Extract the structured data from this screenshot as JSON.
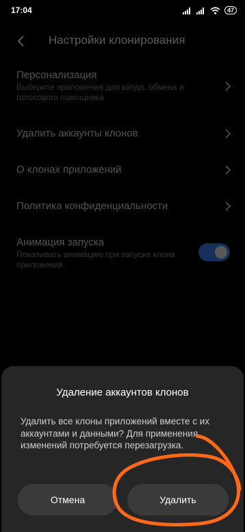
{
  "status_bar": {
    "time": "17:04",
    "battery": "47"
  },
  "header": {
    "title": "Настройки клонирования"
  },
  "settings": [
    {
      "title": "Персонализация",
      "subtitle": "Выберите приложения для входа, обмена и голосового помощника"
    },
    {
      "title": "Удалить аккаунты клонов",
      "subtitle": ""
    },
    {
      "title": "О клонах приложений",
      "subtitle": ""
    },
    {
      "title": "Политика конфиденциальности",
      "subtitle": ""
    },
    {
      "title": "Анимация запуска",
      "subtitle": "Показывать анимацию при запуске клона приложения",
      "toggle": true
    }
  ],
  "dialog": {
    "title": "Удаление аккаунтов клонов",
    "message": "Удалить все клоны приложений вместе с их аккаунтами и данными? Для применения изменений потребуется перезагрузка.",
    "cancel_label": "Отмена",
    "delete_label": "Удалить"
  },
  "colors": {
    "accent": "#3d8bff",
    "annotation": "#ff6a1a",
    "dialog_bg": "#262626"
  }
}
